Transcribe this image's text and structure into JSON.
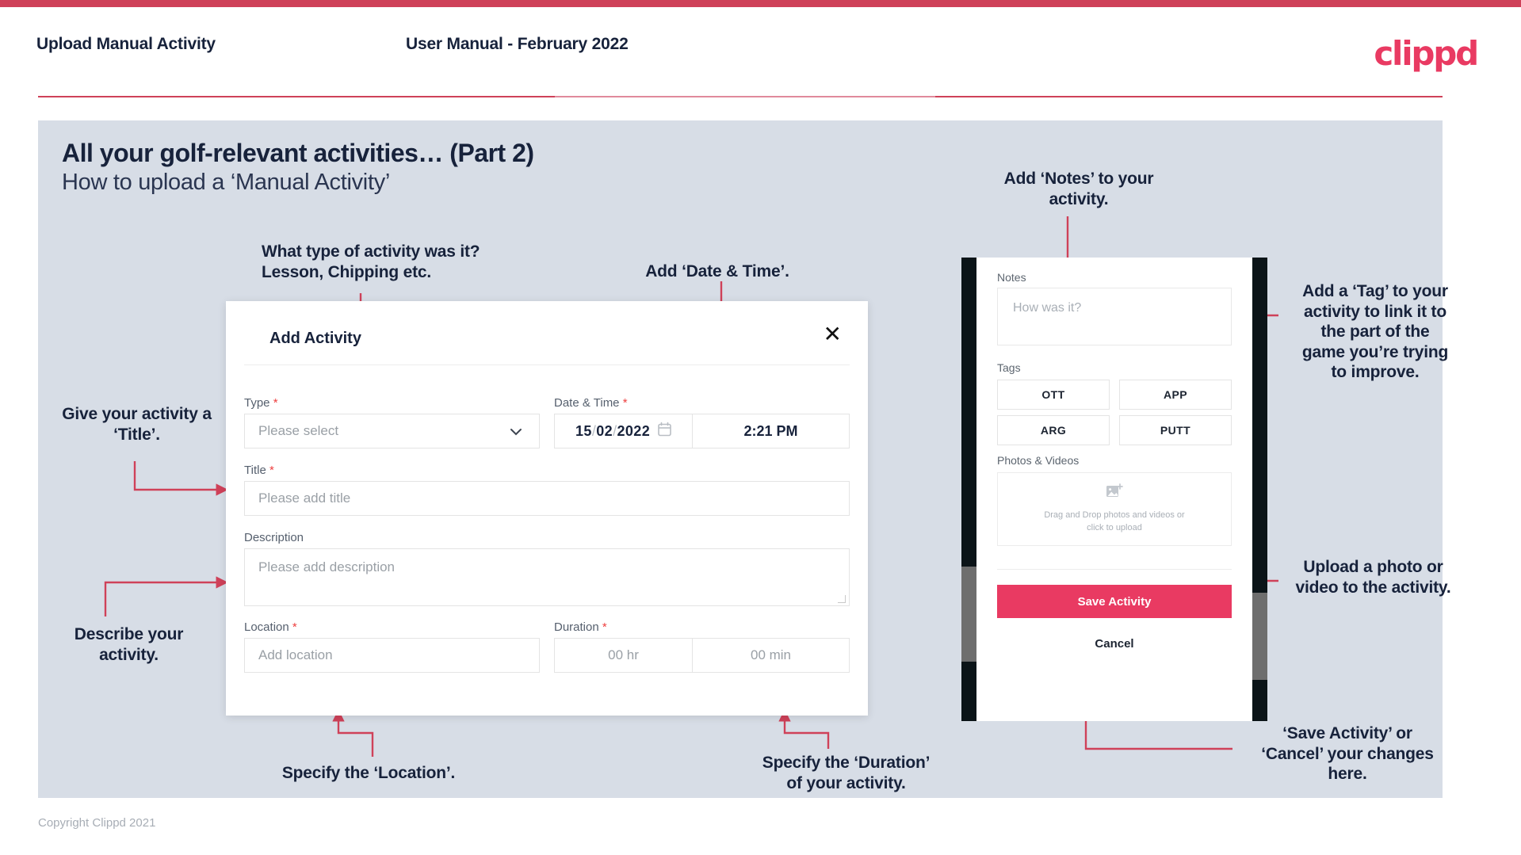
{
  "header": {
    "title": "Upload Manual Activity",
    "subtitle": "User Manual - February 2022",
    "logo": "clippd"
  },
  "slide": {
    "heading": "All your golf-relevant activities… (Part 2)",
    "subheading": "How to upload a ‘Manual Activity’"
  },
  "annotations": {
    "type": "What type of activity was it?\nLesson, Chipping etc.",
    "datetime": "Add ‘Date & Time’.",
    "title": "Give your activity a\n‘Title’.",
    "description": "Describe your\nactivity.",
    "location": "Specify the ‘Location’.",
    "duration": "Specify the ‘Duration’\nof your activity.",
    "notes": "Add ‘Notes’ to your\nactivity.",
    "tags": "Add a ‘Tag’ to your\nactivity to link it to\nthe part of the\ngame you’re trying\nto improve.",
    "photos": "Upload a photo or\nvideo to the activity.",
    "save": "‘Save Activity’ or\n‘Cancel’ your changes\nhere."
  },
  "dialog": {
    "title": "Add Activity",
    "close_icon": "close-icon",
    "fields": {
      "type": {
        "label": "Type",
        "required": "*",
        "placeholder": "Please select",
        "icon": "chevron-down-icon"
      },
      "datetime": {
        "label": "Date & Time",
        "required": "*",
        "day": "15",
        "month": "02",
        "year": "2022",
        "sep": "/",
        "time": "2:21 PM",
        "icon": "calendar-icon"
      },
      "title": {
        "label": "Title",
        "required": "*",
        "placeholder": "Please add title"
      },
      "description": {
        "label": "Description",
        "required": "",
        "placeholder": "Please add description"
      },
      "location": {
        "label": "Location",
        "required": "*",
        "placeholder": "Add location"
      },
      "duration": {
        "label": "Duration",
        "required": "*",
        "hours": "00 hr",
        "minutes": "00 min"
      }
    }
  },
  "phone": {
    "notes": {
      "label": "Notes",
      "placeholder": "How was it?"
    },
    "tags": {
      "label": "Tags",
      "items": [
        "OTT",
        "APP",
        "ARG",
        "PUTT"
      ]
    },
    "photos": {
      "label": "Photos & Videos",
      "dropzone_line1": "Drag and Drop photos and videos or",
      "dropzone_line2": "click to upload",
      "icon": "add-image-icon"
    },
    "save_label": "Save Activity",
    "cancel_label": "Cancel"
  },
  "footer": {
    "copyright": "Copyright Clippd 2021"
  },
  "colors": {
    "accent": "#e93a62",
    "accent_dark": "#cf4159",
    "slide_bg": "#d7dde6",
    "ink": "#17223b"
  }
}
